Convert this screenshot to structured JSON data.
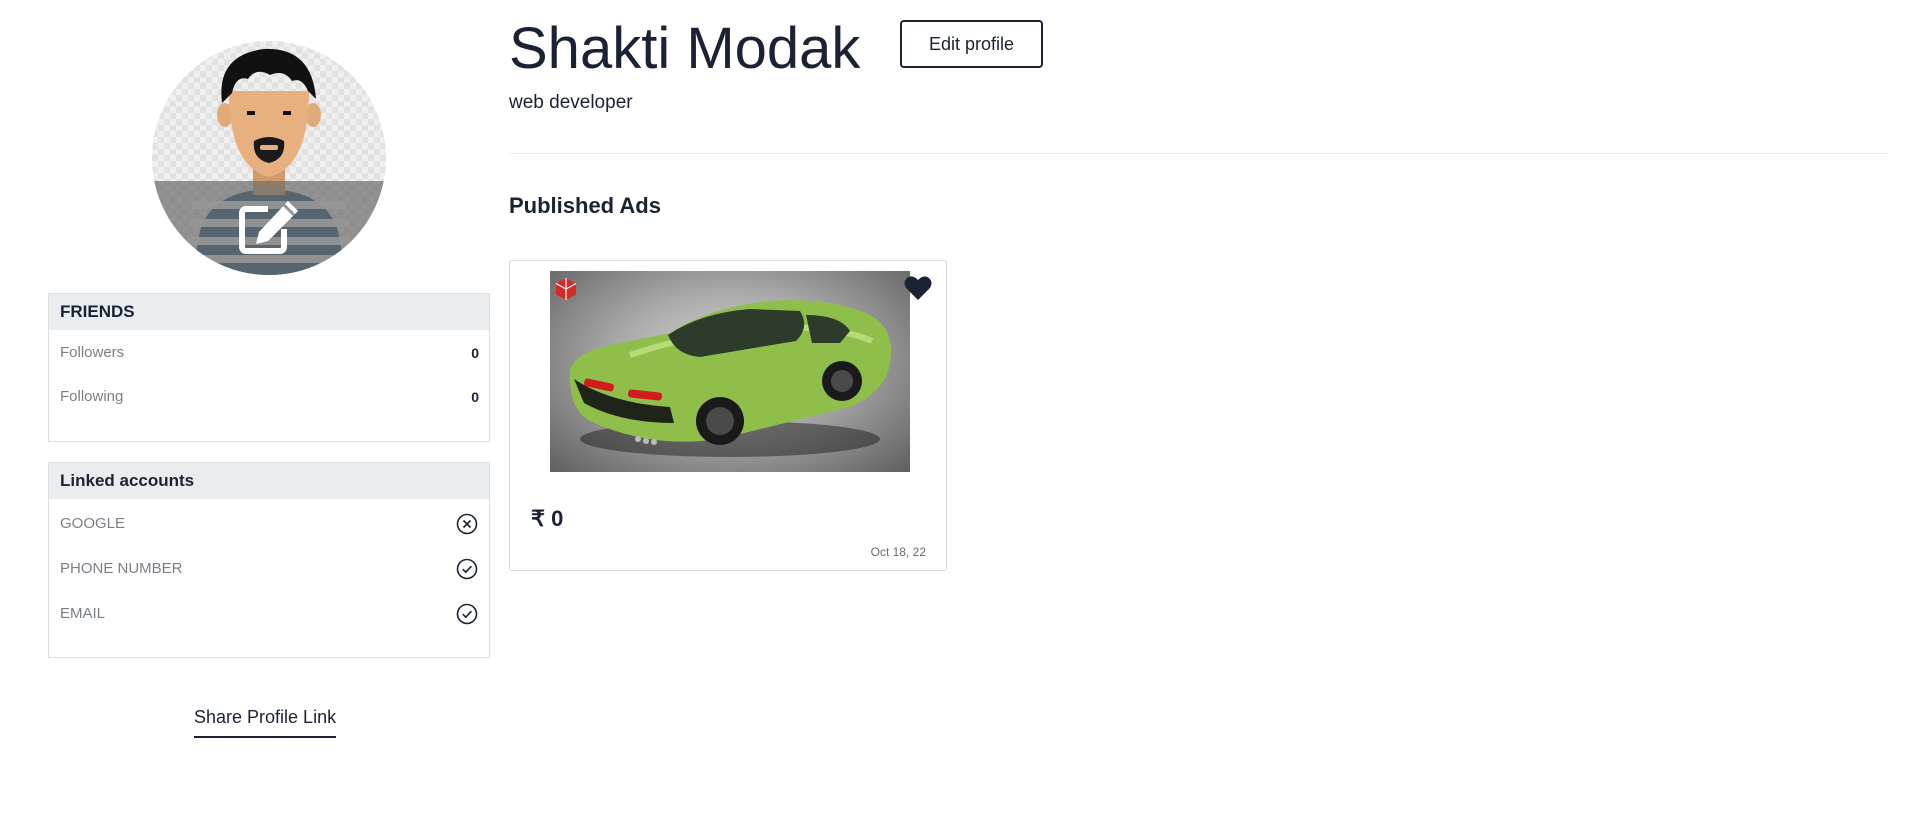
{
  "profile": {
    "name": "Shakti Modak",
    "title": "web developer",
    "edit_button_label": "Edit profile",
    "avatar_icon": "person-avatar-icon",
    "avatar_edit_icon": "edit-pencil-icon"
  },
  "friends": {
    "heading": "FRIENDS",
    "items": [
      {
        "label": "Followers",
        "count": "0"
      },
      {
        "label": "Following",
        "count": "0"
      }
    ]
  },
  "linked_accounts": {
    "heading": "Linked accounts",
    "items": [
      {
        "label": "GOOGLE",
        "status": "not-linked",
        "icon": "x-circle-icon"
      },
      {
        "label": "PHONE NUMBER",
        "status": "linked",
        "icon": "check-circle-icon"
      },
      {
        "label": "EMAIL",
        "status": "linked",
        "icon": "check-circle-icon"
      }
    ]
  },
  "share_link_label": "Share Profile Link",
  "published_ads": {
    "heading": "Published Ads",
    "ads": [
      {
        "price": "₹ 0",
        "date": "Oct 18, 22",
        "image": "green-sports-car",
        "favorite_icon": "heart-icon"
      }
    ]
  },
  "colors": {
    "text_primary": "#1a2233",
    "text_muted": "#7a7f87",
    "panel_header_bg": "#eaedef",
    "border": "#dcdfe2",
    "car_body": "#8fbf4a"
  }
}
